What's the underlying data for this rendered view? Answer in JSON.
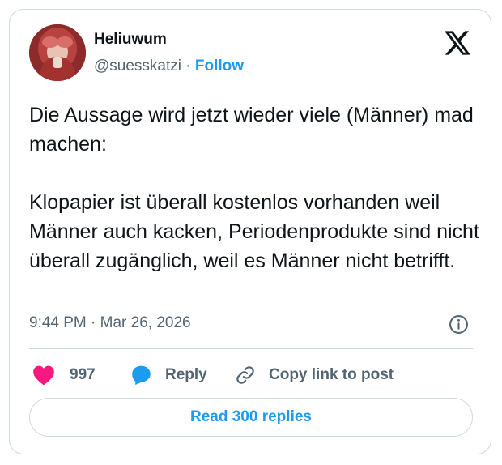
{
  "author": {
    "name": "Heliuwum",
    "handle": "@suesskatzi",
    "separator": " · ",
    "follow_label": "Follow"
  },
  "tweet": {
    "paragraphs": [
      "Die Aussage wird jetzt wieder viele (Männer) mad machen:",
      "Klopapier ist überall kostenlos vorhanden weil Männer auch kacken, Periodenprodukte sind nicht überall zugänglich, weil es Männer nicht betrifft."
    ],
    "timestamp": "9:44 PM · Mar 26, 2026"
  },
  "actions": {
    "likes_count": "997",
    "reply_label": "Reply",
    "copy_link_label": "Copy link to post"
  },
  "read_replies_label": "Read 300 replies",
  "icons": {
    "logo": "x-logo-icon",
    "info": "info-icon",
    "like": "heart-icon",
    "reply": "speech-bubble-icon",
    "copy": "link-icon"
  },
  "colors": {
    "accent": "#1d9bf0",
    "like": "#f91880",
    "text": "#0f1419",
    "muted": "#536471",
    "border": "#cfd9de"
  }
}
